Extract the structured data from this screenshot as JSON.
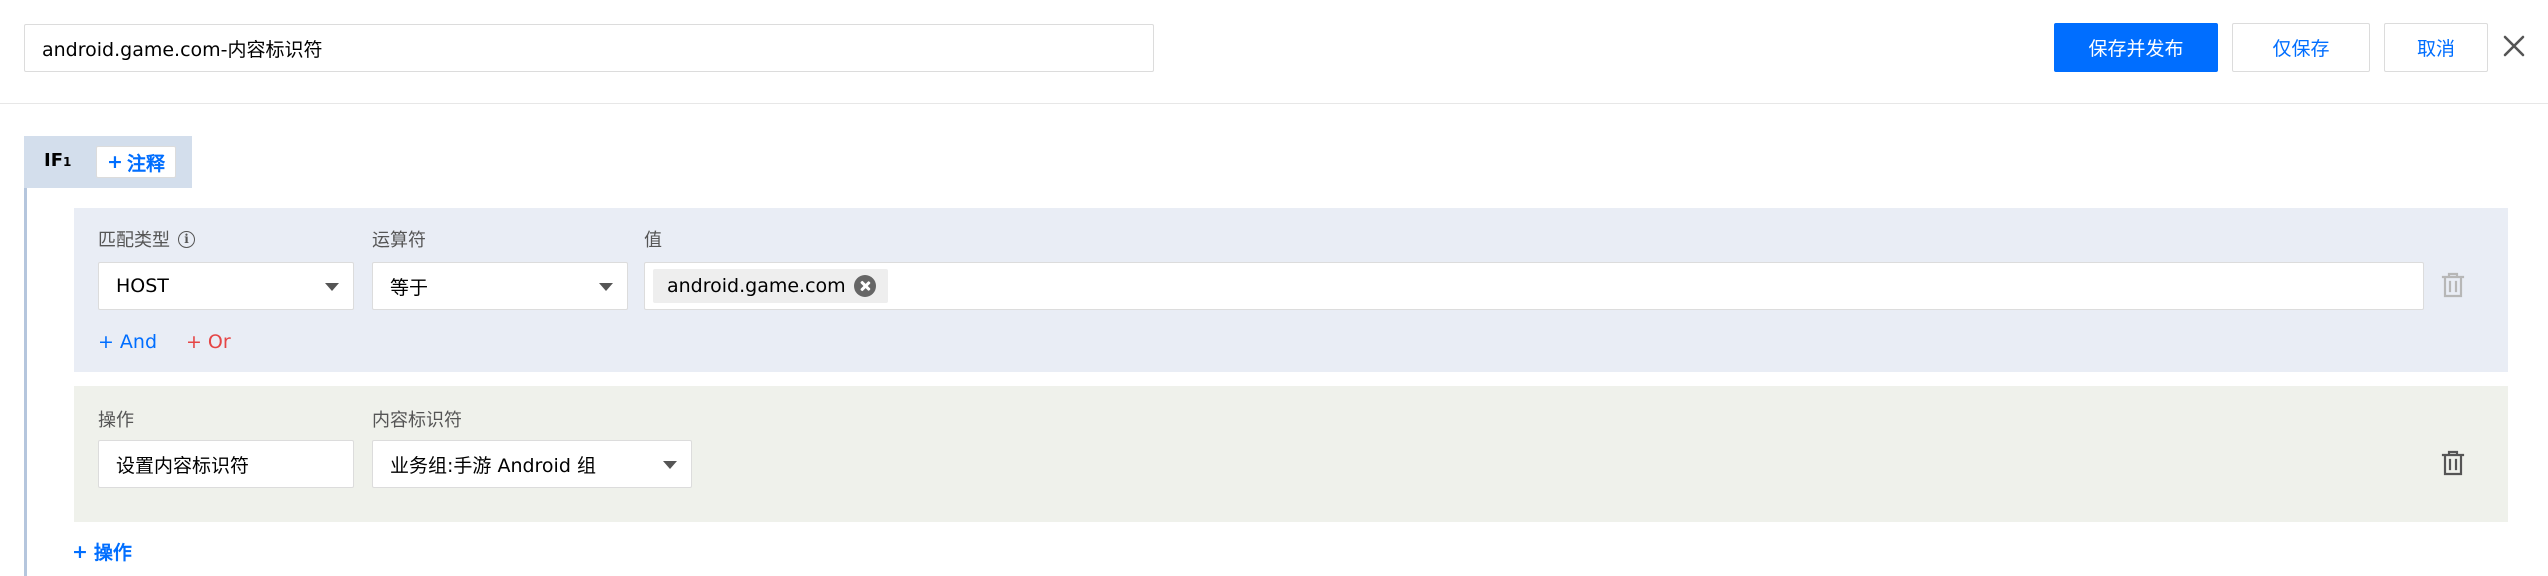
{
  "header": {
    "name_value": "android.game.com-内容标识符",
    "publish_label": "保存并发布",
    "save_label": "仅保存",
    "cancel_label": "取消"
  },
  "rule": {
    "if_label": "IF",
    "if_index": "1",
    "note_label": "注释",
    "condition": {
      "match_type_label": "匹配类型",
      "match_type_value": "HOST",
      "operator_label": "运算符",
      "operator_value": "等于",
      "value_label": "值",
      "value_tags": [
        "android.game.com"
      ],
      "and_label": "And",
      "or_label": "Or"
    },
    "action": {
      "operation_label": "操作",
      "operation_value": "设置内容标识符",
      "identifier_label": "内容标识符",
      "identifier_value": "业务组:手游 Android 组"
    },
    "add_action_label": "操作"
  },
  "colors": {
    "accent": "#006eff",
    "danger": "#e54545",
    "condition_bg": "#e9edf5",
    "action_bg": "#eff1eb",
    "if_header_bg": "#d3deec"
  },
  "icons": {
    "close": "close-icon",
    "info": "info-icon",
    "caret": "chevron-down-icon",
    "tag_remove": "tag-remove-icon",
    "delete": "trash-icon",
    "plus": "plus-icon"
  }
}
